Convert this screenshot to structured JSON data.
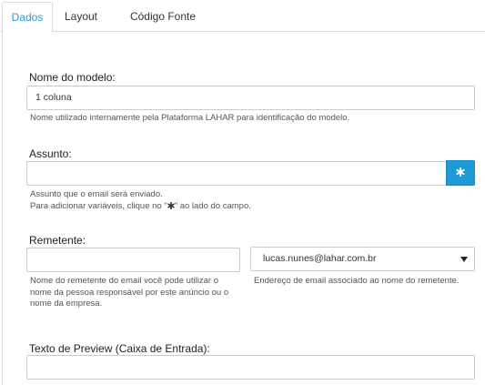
{
  "tabs": [
    {
      "label": "Dados",
      "active": true
    },
    {
      "label": "Layout",
      "active": false
    },
    {
      "label": "Código Fonte",
      "active": false
    }
  ],
  "form": {
    "model_name": {
      "label": "Nome do modelo:",
      "value": "1 coluna",
      "help": "Nome utilizado internamente pela Plataforma LAHAR para identificação do modelo."
    },
    "subject": {
      "label": "Assunto:",
      "value": "",
      "help_line1": "Assunto que o email será enviado.",
      "help_line2_before": "Para adicionar variáveis, clique no \"",
      "help_line2_after": "\" ao lado do campo.",
      "button_icon": "asterisk-icon"
    },
    "sender": {
      "label": "Remetente:",
      "name_value": "",
      "name_help": [
        "Nome do remetente do email você pode utilizar o",
        "nome da pessoa responsável por este anúncio ou o",
        "nome da empresa."
      ],
      "email_value": "lucas.nunes@lahar.com.br",
      "email_help": "Endereço de email associado ao nome do remetente."
    },
    "preview": {
      "label": "Texto de Preview (Caixa de Entrada):",
      "value": ""
    }
  },
  "colors": {
    "accent": "#2a9fd6",
    "button": "#1f9ad8",
    "border": "#cccccc"
  }
}
